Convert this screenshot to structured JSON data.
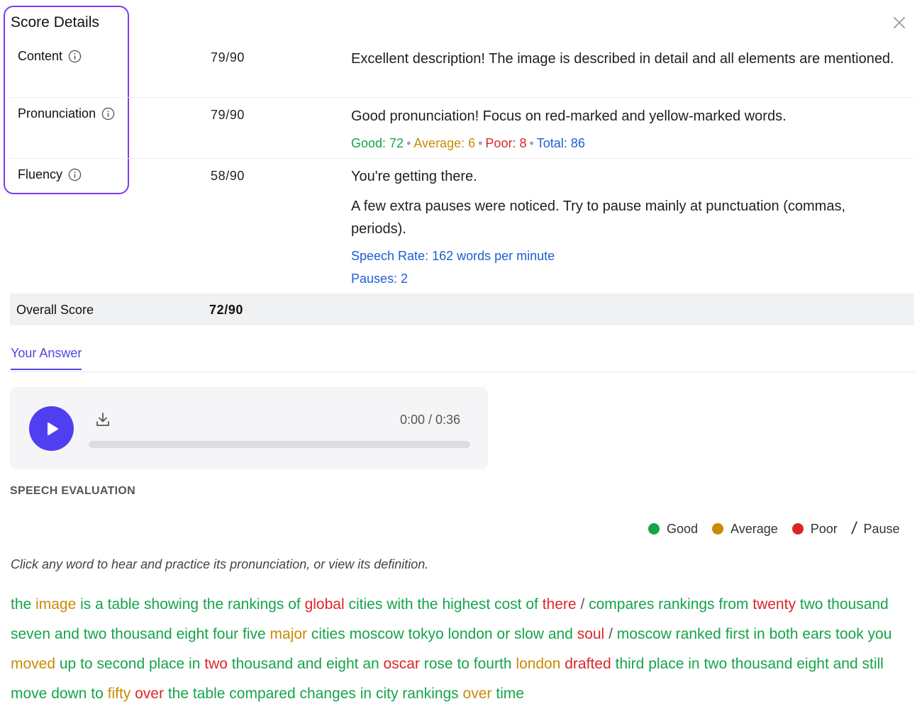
{
  "header": {
    "title": "Score Details",
    "close_icon": "close-icon"
  },
  "colors": {
    "good": "#16a34a",
    "average": "#ca8a04",
    "poor": "#dc2626",
    "accent": "#4f46e5",
    "info": "#1d5fd1"
  },
  "scores": [
    {
      "name": "Content",
      "score": "79/90",
      "feedback": [
        "Excellent description! The image is described in detail and all elements are mentioned."
      ]
    },
    {
      "name": "Pronunciation",
      "score": "79/90",
      "feedback": [
        "Good pronunciation! Focus on red-marked and yellow-marked words."
      ],
      "stats": {
        "good": "Good: 72",
        "average": "Average: 6",
        "poor": "Poor: 8",
        "total": "Total: 86"
      }
    },
    {
      "name": "Fluency",
      "score": "58/90",
      "feedback": [
        "You're getting there.",
        "A few extra pauses were noticed. Try to pause mainly at punctuation (commas, periods)."
      ],
      "speech_rate": "Speech Rate: 162 words per minute",
      "pauses": "Pauses: 2"
    }
  ],
  "overall": {
    "label": "Overall Score",
    "score": "72/90"
  },
  "tab": {
    "label": "Your Answer"
  },
  "player": {
    "time": "0:00 / 0:36",
    "progress": 0
  },
  "speech_evaluation": {
    "heading": "SPEECH EVALUATION",
    "legend": {
      "good": "Good",
      "average": "Average",
      "poor": "Poor",
      "pause": "Pause"
    },
    "hint": "Click any word to hear and practice its pronunciation, or view its definition.",
    "words": [
      [
        "the",
        "good"
      ],
      [
        "image",
        "average"
      ],
      [
        "is",
        "good"
      ],
      [
        "a",
        "good"
      ],
      [
        "table",
        "good"
      ],
      [
        "showing",
        "good"
      ],
      [
        "the",
        "good"
      ],
      [
        "rankings",
        "good"
      ],
      [
        "of",
        "good"
      ],
      [
        "global",
        "poor"
      ],
      [
        "cities",
        "good"
      ],
      [
        "with",
        "good"
      ],
      [
        "the",
        "good"
      ],
      [
        "highest",
        "good"
      ],
      [
        "cost",
        "good"
      ],
      [
        "of",
        "good"
      ],
      [
        "there",
        "poor"
      ],
      [
        "/",
        "pause"
      ],
      [
        "compares",
        "good"
      ],
      [
        "rankings",
        "good"
      ],
      [
        "from",
        "good"
      ],
      [
        "twenty",
        "poor"
      ],
      [
        "two",
        "good"
      ],
      [
        "thousand",
        "good"
      ],
      [
        "seven",
        "good"
      ],
      [
        "and",
        "good"
      ],
      [
        "two",
        "good"
      ],
      [
        "thousand",
        "good"
      ],
      [
        "eight",
        "good"
      ],
      [
        "four",
        "good"
      ],
      [
        "five",
        "good"
      ],
      [
        "major",
        "average"
      ],
      [
        "cities",
        "good"
      ],
      [
        "moscow",
        "good"
      ],
      [
        "tokyo",
        "good"
      ],
      [
        "london",
        "good"
      ],
      [
        "or",
        "good"
      ],
      [
        "slow",
        "good"
      ],
      [
        "and",
        "good"
      ],
      [
        "soul",
        "poor"
      ],
      [
        "/",
        "pause"
      ],
      [
        "moscow",
        "good"
      ],
      [
        "ranked",
        "good"
      ],
      [
        "first",
        "good"
      ],
      [
        "in",
        "good"
      ],
      [
        "both",
        "good"
      ],
      [
        "ears",
        "good"
      ],
      [
        "took",
        "good"
      ],
      [
        "you",
        "good"
      ],
      [
        "moved",
        "average"
      ],
      [
        "up",
        "good"
      ],
      [
        "to",
        "good"
      ],
      [
        "second",
        "good"
      ],
      [
        "place",
        "good"
      ],
      [
        "in",
        "good"
      ],
      [
        "two",
        "poor"
      ],
      [
        "thousand",
        "good"
      ],
      [
        "and",
        "good"
      ],
      [
        "eight",
        "good"
      ],
      [
        "an",
        "good"
      ],
      [
        "oscar",
        "poor"
      ],
      [
        "rose",
        "good"
      ],
      [
        "to",
        "good"
      ],
      [
        "fourth",
        "good"
      ],
      [
        "london",
        "average"
      ],
      [
        "drafted",
        "poor"
      ],
      [
        "third",
        "good"
      ],
      [
        "place",
        "good"
      ],
      [
        "in",
        "good"
      ],
      [
        "two",
        "good"
      ],
      [
        "thousand",
        "good"
      ],
      [
        "eight",
        "good"
      ],
      [
        "and",
        "good"
      ],
      [
        "still",
        "good"
      ],
      [
        "move",
        "good"
      ],
      [
        "down",
        "good"
      ],
      [
        "to",
        "good"
      ],
      [
        "fifty",
        "average"
      ],
      [
        "over",
        "poor"
      ],
      [
        "the",
        "good"
      ],
      [
        "table",
        "good"
      ],
      [
        "compared",
        "good"
      ],
      [
        "changes",
        "good"
      ],
      [
        "in",
        "good"
      ],
      [
        "city",
        "good"
      ],
      [
        "rankings",
        "good"
      ],
      [
        "over",
        "average"
      ],
      [
        "time",
        "good"
      ]
    ]
  }
}
